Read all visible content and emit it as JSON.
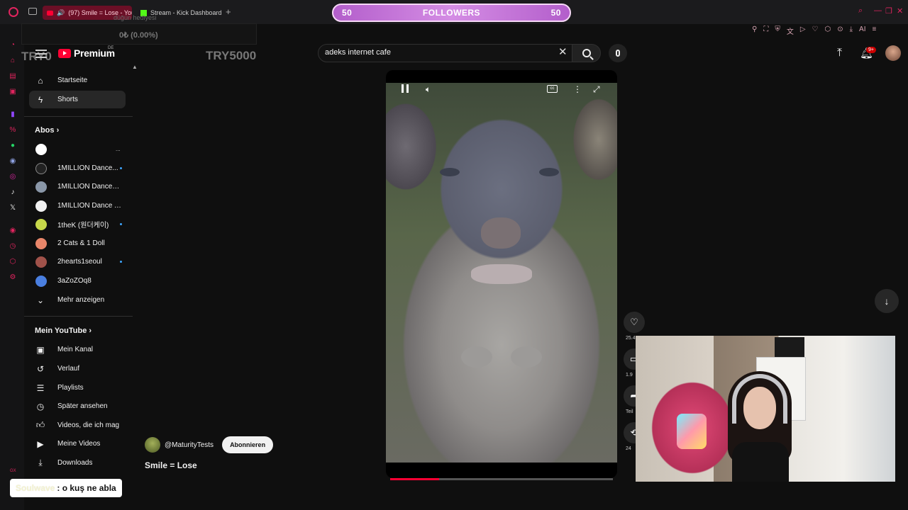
{
  "browser": {
    "tabs": [
      {
        "label": "(97) Smile = Lose - YouTube",
        "active": true
      },
      {
        "label": "Stream - Kick Dashboard",
        "active": false
      }
    ],
    "new_tab": "+",
    "gx_label": "GX",
    "accent_color": "#e0245e"
  },
  "extensions_bar": [
    "pin-icon",
    "crop-icon",
    "shield-icon",
    "translate-icon",
    "play-icon",
    "heart-icon",
    "puzzle-icon",
    "lock-icon",
    "download-icon",
    "ai-icon",
    "menu-icon"
  ],
  "extensions_ai": "AI",
  "overlay": {
    "goal_left": "50",
    "goal_title": "FOLLOWERS",
    "goal_right": "50",
    "donation_label": "düğün hediyesi",
    "donation_progress": "0₺ (0.00%)",
    "try_left": "TRY0",
    "try_right": "TRY5000"
  },
  "header": {
    "logo_text": "Premium",
    "country": "DE",
    "search_value": "adeks internet cafe",
    "notification_count": "9+"
  },
  "sidebar": {
    "main": [
      {
        "label": "Startseite",
        "icon": "home-icon"
      },
      {
        "label": "Shorts",
        "icon": "shorts-icon",
        "active": true
      }
    ],
    "subs_heading": "Abos",
    "subscriptions": [
      {
        "label": "",
        "color": "#ffffff",
        "live": false,
        "ellipsis": "..."
      },
      {
        "label": "1MILLION Dance...",
        "color": "#222222",
        "live": true
      },
      {
        "label": "1MILLION Dance St...",
        "color": "#8a97a8",
        "live": false
      },
      {
        "label": "1MILLION Dance T...",
        "color": "#f1f1f1",
        "live": false
      },
      {
        "label": "1theK (원더케이)",
        "color": "#c7d84a",
        "live": true
      },
      {
        "label": "2 Cats & 1 Doll",
        "color": "#e8866a",
        "live": false
      },
      {
        "label": "2hearts1seoul",
        "color": "#a0524a",
        "live": true
      },
      {
        "label": "3aZoZOq8",
        "color": "#4a7fe0",
        "live": false
      }
    ],
    "more_label": "Mehr anzeigen",
    "you_heading": "Mein YouTube",
    "you_items": [
      {
        "label": "Mein Kanal",
        "icon": "channel-icon"
      },
      {
        "label": "Verlauf",
        "icon": "history-icon"
      },
      {
        "label": "Playlists",
        "icon": "playlists-icon"
      },
      {
        "label": "Später ansehen",
        "icon": "watch-later-icon"
      },
      {
        "label": "Videos, die ich mag",
        "icon": "like-icon"
      },
      {
        "label": "Meine Videos",
        "icon": "my-videos-icon"
      },
      {
        "label": "Downloads",
        "icon": "download-icon"
      }
    ]
  },
  "short": {
    "channel": "@MaturityTests",
    "subscribe_label": "Abonnieren",
    "title": "Smile = Lose",
    "progress": 0.22,
    "actions": [
      {
        "icon": "like-icon",
        "count": "25.4"
      },
      {
        "icon": "comment-icon",
        "count": "1.9"
      },
      {
        "icon": "share-icon",
        "count": "Teil"
      },
      {
        "icon": "remix-icon",
        "count": "24"
      }
    ]
  },
  "chat": {
    "username": "Soulwave",
    "message": ": o kuş ne abla"
  }
}
